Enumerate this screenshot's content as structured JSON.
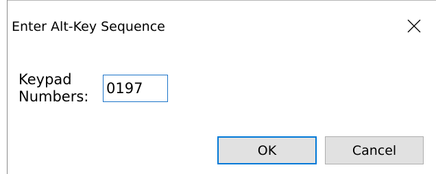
{
  "dialog": {
    "title": "Enter Alt-Key Sequence",
    "close_icon": "close-icon"
  },
  "form": {
    "label_line1": "Keypad",
    "label_line2": "Numbers:",
    "input_value": "0197"
  },
  "buttons": {
    "ok_label": "OK",
    "cancel_label": "Cancel"
  },
  "colors": {
    "focus_accent": "#0078d7",
    "input_border": "#1a73c8",
    "button_face": "#e1e1e1"
  }
}
